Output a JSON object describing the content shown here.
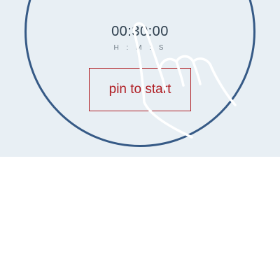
{
  "timer": {
    "time": "00:30:00",
    "units": "H : M : S"
  },
  "start_button": {
    "label": "pin to start"
  },
  "gesture": {
    "icon": "hand-swipe-icon"
  },
  "colors": {
    "panel_background": "#e8eff4",
    "dial_ring": "#365a86",
    "start_button": "#b01e24",
    "time_text": "#2d3e4d"
  }
}
